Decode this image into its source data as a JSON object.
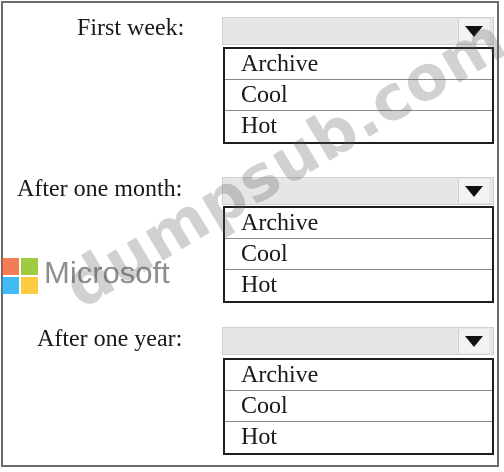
{
  "groups": [
    {
      "label": "First week:",
      "selected": "",
      "options": [
        "Archive",
        "Cool",
        "Hot"
      ]
    },
    {
      "label": "After one month:",
      "selected": "",
      "options": [
        "Archive",
        "Cool",
        "Hot"
      ]
    },
    {
      "label": "After one year:",
      "selected": "",
      "options": [
        "Archive",
        "Cool",
        "Hot"
      ]
    }
  ],
  "logo": {
    "text": "Microsoft",
    "colors": [
      "#f25022",
      "#7fba00",
      "#00a4ef",
      "#ffb900"
    ]
  },
  "watermark": "dumpsub.com"
}
